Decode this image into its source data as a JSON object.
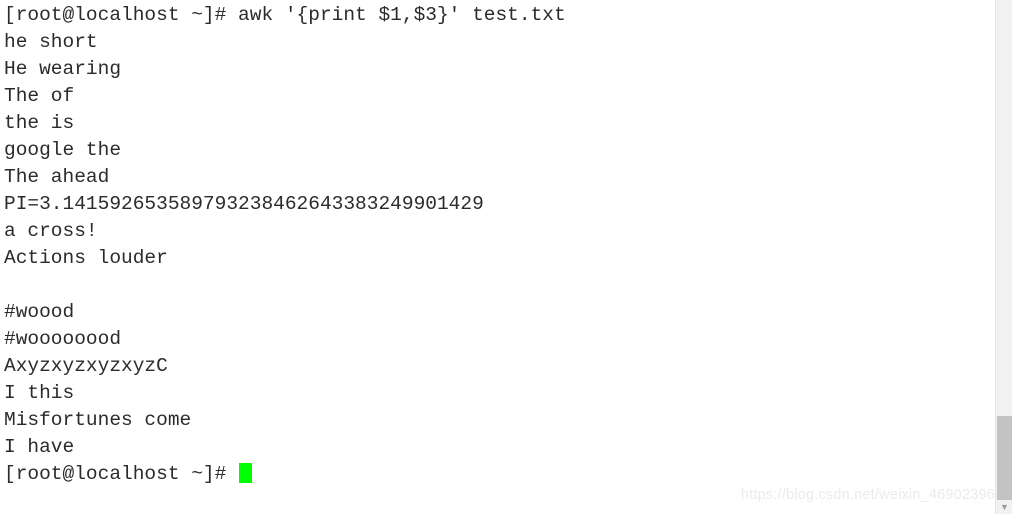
{
  "terminal": {
    "title": "root@localhost terminal",
    "background_color": "#ffffff",
    "text_color": "#2b2b2b",
    "cursor_color": "#00ff00",
    "prompt": "[root@localhost ~]#",
    "command": "awk '{print $1,$3}' test.txt",
    "lines": [
      {
        "id": "line-command",
        "text": "[root@localhost ~]# awk '{print $1,$3}' test.txt"
      },
      {
        "id": "line-out-1",
        "text": "he short"
      },
      {
        "id": "line-out-2",
        "text": "He wearing"
      },
      {
        "id": "line-out-3",
        "text": "The of"
      },
      {
        "id": "line-out-4",
        "text": "the is"
      },
      {
        "id": "line-out-5",
        "text": "google the"
      },
      {
        "id": "line-out-6",
        "text": "The ahead"
      },
      {
        "id": "line-out-7",
        "text": "PI=3.141592653589793238462643383249901429"
      },
      {
        "id": "line-out-8",
        "text": "a cross!"
      },
      {
        "id": "line-out-9",
        "text": "Actions louder"
      },
      {
        "id": "line-out-10",
        "text": ""
      },
      {
        "id": "line-out-11",
        "text": "#woood"
      },
      {
        "id": "line-out-12",
        "text": "#woooooood"
      },
      {
        "id": "line-out-13",
        "text": "AxyzxyzxyzxyzC"
      },
      {
        "id": "line-out-14",
        "text": "I this"
      },
      {
        "id": "line-out-15",
        "text": "Misfortunes come"
      },
      {
        "id": "line-out-16",
        "text": "I have"
      }
    ],
    "final_prompt": "[root@localhost ~]# "
  },
  "watermark": {
    "text": "https://blog.csdn.net/weixin_46902396"
  },
  "scrollbar": {
    "down_arrow_glyph": "▼"
  }
}
